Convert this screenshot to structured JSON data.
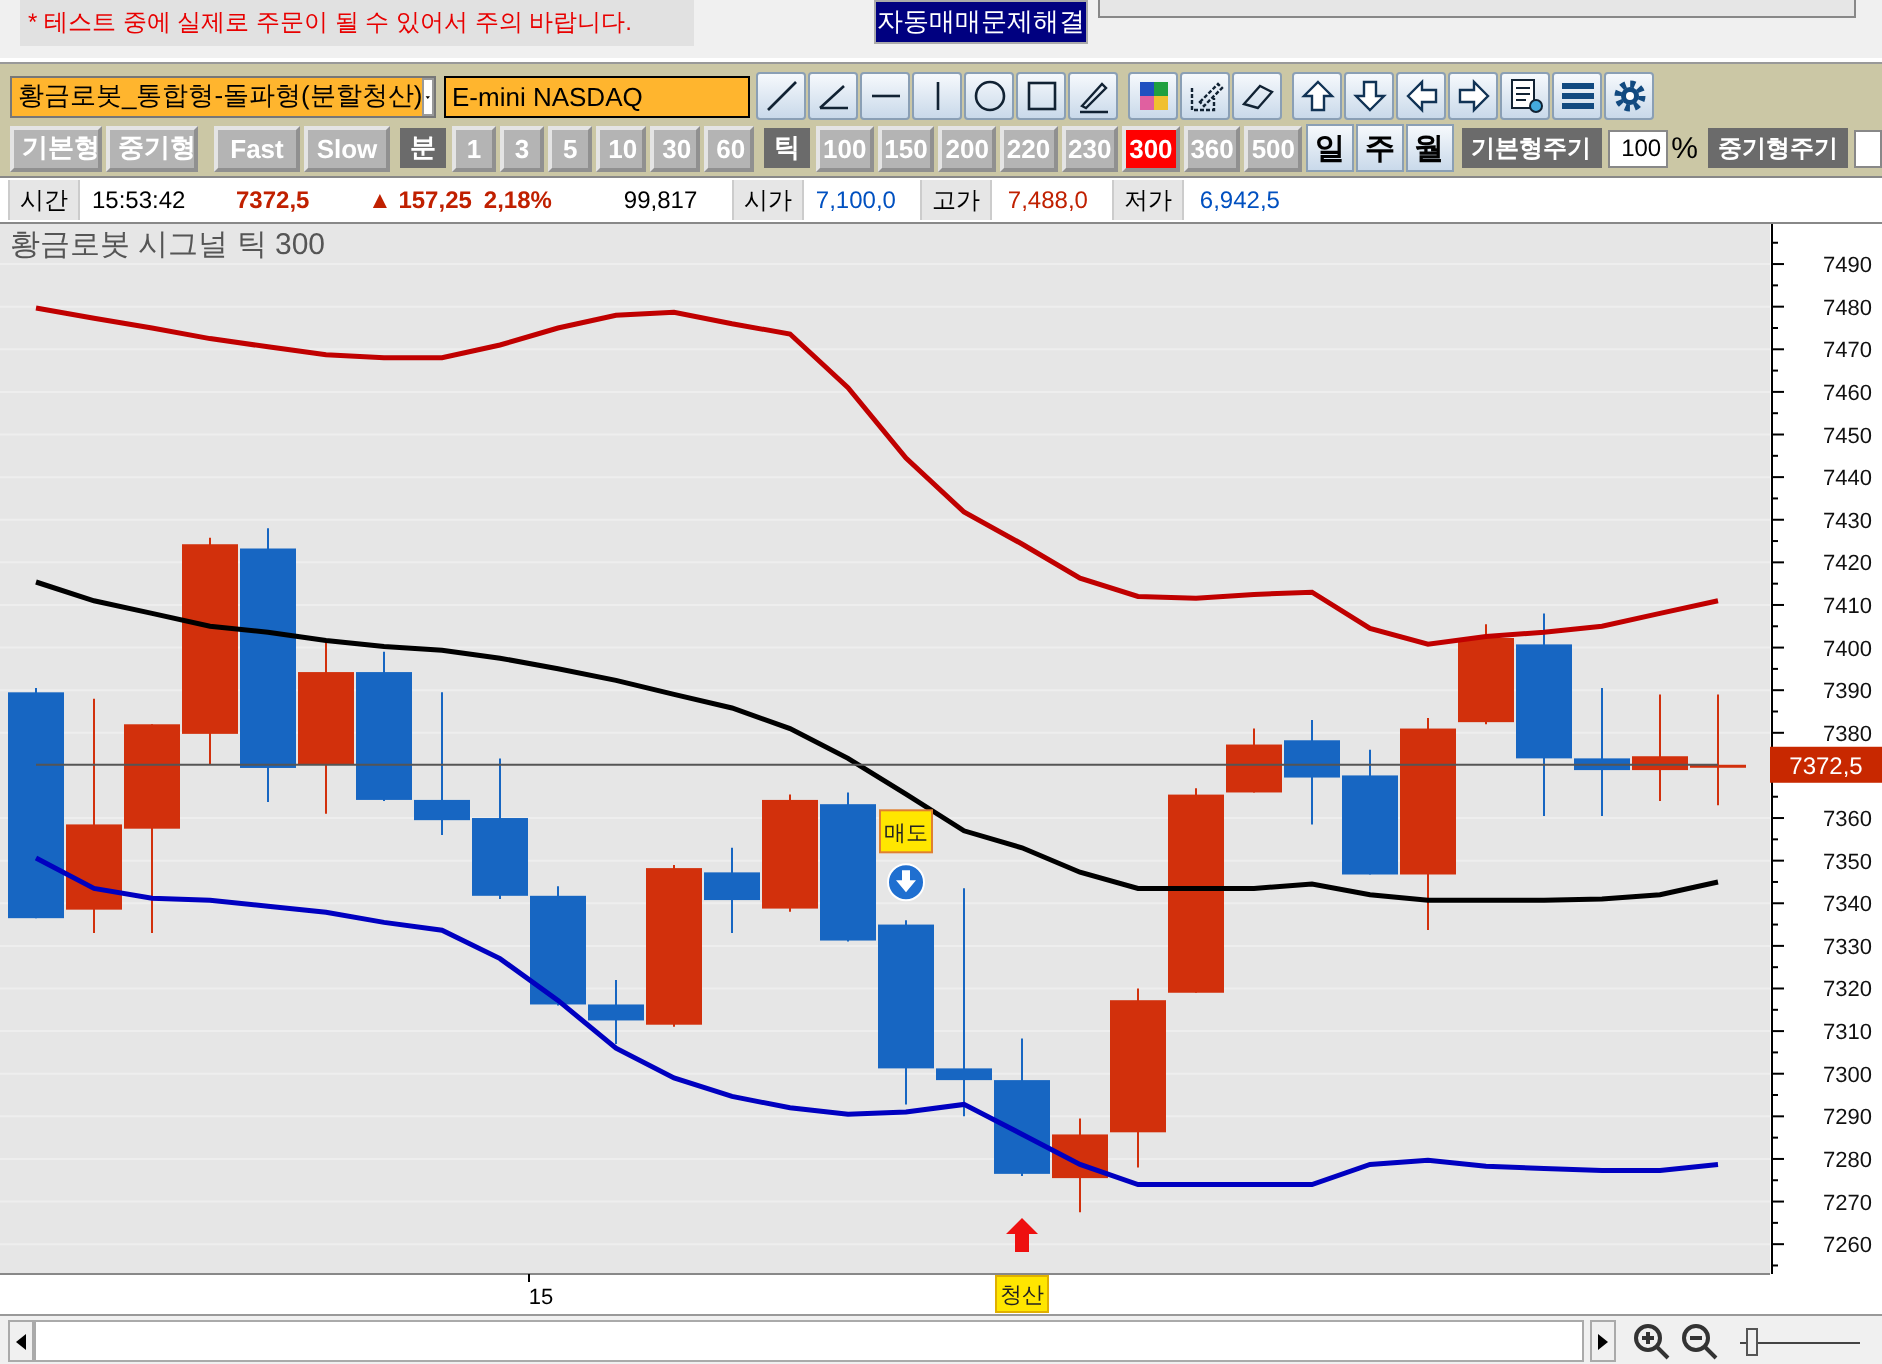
{
  "notice": {
    "text": "* 테스트 중에 실제로 주문이 될 수 있어서 주의 바랍니다."
  },
  "fix_button": {
    "label": "자동매매문제해결"
  },
  "strategy_select": {
    "value": "황금로봇_통합형-돌파형(분할청산)"
  },
  "symbol": {
    "value": "E-mini NASDAQ"
  },
  "chart_types": [
    {
      "label": "기본형"
    },
    {
      "label": "중기형"
    }
  ],
  "speeds": [
    {
      "label": "Fast"
    },
    {
      "label": "Slow"
    }
  ],
  "minute_periods": {
    "label": "분",
    "items": [
      {
        "label": "1",
        "selected": false
      },
      {
        "label": "3",
        "selected": false
      },
      {
        "label": "5",
        "selected": false
      },
      {
        "label": "10",
        "selected": false
      },
      {
        "label": "30",
        "selected": false
      },
      {
        "label": "60",
        "selected": false
      }
    ]
  },
  "tick_periods": {
    "label": "틱",
    "items": [
      {
        "label": "100",
        "selected": false
      },
      {
        "label": "150",
        "selected": false
      },
      {
        "label": "200",
        "selected": false
      },
      {
        "label": "220",
        "selected": false
      },
      {
        "label": "230",
        "selected": false
      },
      {
        "label": "300",
        "selected": true
      },
      {
        "label": "360",
        "selected": false
      },
      {
        "label": "500",
        "selected": false
      }
    ]
  },
  "calendar_periods": [
    {
      "label": "일"
    },
    {
      "label": "주"
    },
    {
      "label": "월"
    }
  ],
  "basic_cycle": {
    "label": "기본형주기",
    "value": "100",
    "unit": "%"
  },
  "mid_cycle": {
    "label": "중기형주기"
  },
  "quote": {
    "time_label": "시간",
    "time": "15:53:42",
    "price": "7372,5",
    "change": "▲ 157,25",
    "change_pct": "2,18%",
    "volume": "99,817",
    "open_label": "시가",
    "open": "7,100,0",
    "high_label": "고가",
    "high": "7,488,0",
    "low_label": "저가",
    "low": "6,942,5"
  },
  "chart": {
    "title": "황금로봇 시그널  틱 300",
    "chart_data": {
      "type": "line",
      "grid": true,
      "ylim": [
        7253,
        7499.4
      ],
      "yticks": [
        {
          "value": 7260,
          "label": "7260"
        },
        {
          "value": 7270,
          "label": "7270"
        },
        {
          "value": 7280,
          "label": "7280"
        },
        {
          "value": 7290,
          "label": "7290"
        },
        {
          "value": 7300,
          "label": "7300"
        },
        {
          "value": 7310,
          "label": "7310"
        },
        {
          "value": 7320,
          "label": "7320"
        },
        {
          "value": 7330,
          "label": "7330"
        },
        {
          "value": 7340,
          "label": "7340"
        },
        {
          "value": 7350,
          "label": "7350"
        },
        {
          "value": 7360,
          "label": "7360"
        },
        {
          "value": 7380,
          "label": "7380"
        },
        {
          "value": 7390,
          "label": "7390"
        },
        {
          "value": 7400,
          "label": "7400"
        },
        {
          "value": 7410,
          "label": "7410"
        },
        {
          "value": 7420,
          "label": "7420"
        },
        {
          "value": 7430,
          "label": "7430"
        },
        {
          "value": 7440,
          "label": "7440"
        },
        {
          "value": 7450,
          "label": "7450"
        },
        {
          "value": 7460,
          "label": "7460"
        },
        {
          "value": 7470,
          "label": "7470"
        },
        {
          "value": 7480,
          "label": "7480"
        },
        {
          "value": 7490,
          "label": "7490"
        }
      ],
      "series": [
        {
          "color": "#c00000",
          "values": [
            7479.7,
            7477.3,
            7475,
            7472.5,
            7470.6,
            7468.7,
            7468,
            7468,
            7471,
            7475,
            7478,
            7478.7,
            7476,
            7473.6,
            7461,
            7444.5,
            7431.8,
            7424.3,
            7416.3,
            7412,
            7411.6,
            7412.5,
            7413,
            7404.5,
            7400.8,
            7402.6,
            7403.6,
            7405,
            7408,
            7411
          ]
        },
        {
          "color": "#000000",
          "values": [
            7415.4,
            7411,
            7408,
            7405,
            7403.6,
            7401.7,
            7400.3,
            7399.4,
            7397.5,
            7395,
            7392.3,
            7389,
            7385.8,
            7381,
            7374,
            7365.6,
            7357,
            7353,
            7347.3,
            7343.5,
            7343.5,
            7343.5,
            7344.5,
            7342,
            7340.7,
            7340.7,
            7340.7,
            7341,
            7342,
            7345
          ]
        },
        {
          "color": "#0000c0",
          "values": [
            7350.6,
            7343.5,
            7341.2,
            7340.7,
            7339.3,
            7337.9,
            7335.5,
            7333.7,
            7327,
            7317.2,
            7306,
            7299,
            7294.7,
            7292,
            7290.5,
            7291,
            7292.8,
            7285.8,
            7278.7,
            7274,
            7274,
            7274,
            7274,
            7278.7,
            7279.7,
            7278.3,
            7277.8,
            7277.3,
            7277.3,
            7278.7
          ]
        },
        {
          "color": "#555555",
          "values": [
            7372.5,
            7372.5,
            7372.5,
            7372.5,
            7372.5,
            7372.5,
            7372.5,
            7372.5,
            7372.5,
            7372.5,
            7372.5,
            7372.5,
            7372.5,
            7372.5,
            7372.5,
            7372.5,
            7372.5,
            7372.5,
            7372.5,
            7372.5,
            7372.5,
            7372.5,
            7372.5,
            7372.5,
            7372.5,
            7372.5,
            7372.5,
            7372.5,
            7372.5,
            7372.5
          ]
        }
      ],
      "annotations": [
        "15",
        "매도",
        "청산",
        "7372,5"
      ]
    }
  },
  "zoom": {
    "level": 0.05
  }
}
